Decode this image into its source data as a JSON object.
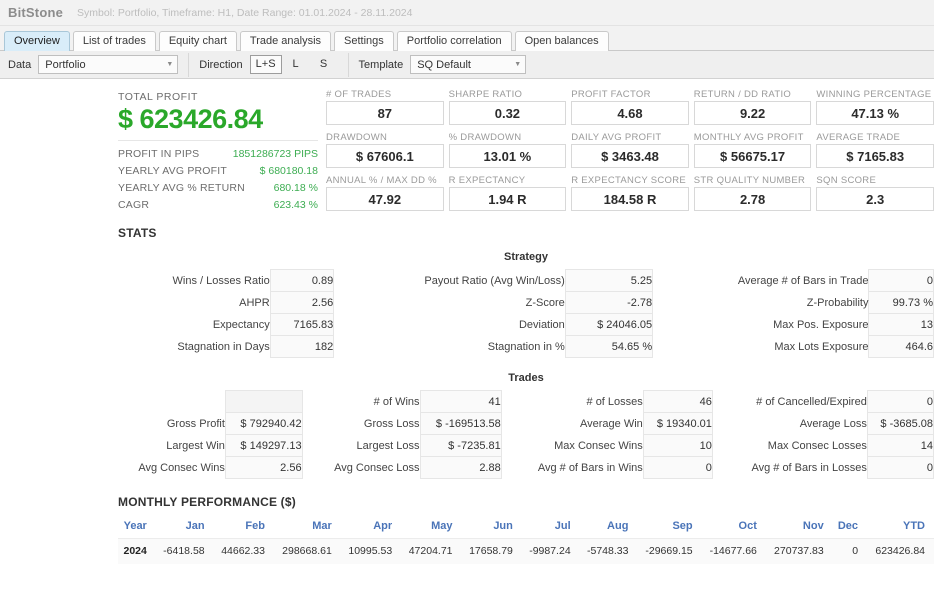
{
  "titlebar": {
    "app_name": "BitStone",
    "meta": "Symbol: Portfolio, Timeframe: H1, Date Range: 01.01.2024 - 28.11.2024"
  },
  "tabs": [
    {
      "label": "Overview",
      "active": true
    },
    {
      "label": "List of trades",
      "active": false
    },
    {
      "label": "Equity chart",
      "active": false
    },
    {
      "label": "Trade analysis",
      "active": false
    },
    {
      "label": "Settings",
      "active": false
    },
    {
      "label": "Portfolio correlation",
      "active": false
    },
    {
      "label": "Open balances",
      "active": false
    }
  ],
  "toolbar": {
    "data_label": "Data",
    "data_value": "Portfolio",
    "direction_label": "Direction",
    "direction_options": [
      "L+S",
      "L",
      "S"
    ],
    "direction_selected": "L+S",
    "template_label": "Template",
    "template_value": "SQ Default"
  },
  "summary": {
    "total_profit_label": "TOTAL PROFIT",
    "total_profit_value": "$ 623426.84",
    "mini": [
      {
        "key": "PROFIT IN PIPS",
        "value": "1851286723 PIPS"
      },
      {
        "key": "YEARLY AVG PROFIT",
        "value": "$ 680180.18"
      },
      {
        "key": "YEARLY AVG % RETURN",
        "value": "680.18 %"
      },
      {
        "key": "CAGR",
        "value": "623.43 %"
      }
    ]
  },
  "kpis": [
    {
      "label": "# OF TRADES",
      "value": "87"
    },
    {
      "label": "SHARPE RATIO",
      "value": "0.32"
    },
    {
      "label": "PROFIT FACTOR",
      "value": "4.68"
    },
    {
      "label": "RETURN / DD RATIO",
      "value": "9.22"
    },
    {
      "label": "WINNING PERCENTAGE",
      "value": "47.13 %"
    },
    {
      "label": "DRAWDOWN",
      "value": "$ 67606.1"
    },
    {
      "label": "% DRAWDOWN",
      "value": "13.01 %"
    },
    {
      "label": "DAILY AVG PROFIT",
      "value": "$ 3463.48"
    },
    {
      "label": "MONTHLY AVG PROFIT",
      "value": "$ 56675.17"
    },
    {
      "label": "AVERAGE TRADE",
      "value": "$ 7165.83"
    },
    {
      "label": "ANNUAL % / MAX DD %",
      "value": "47.92"
    },
    {
      "label": "R EXPECTANCY",
      "value": "1.94 R"
    },
    {
      "label": "R EXPECTANCY SCORE",
      "value": "184.58 R"
    },
    {
      "label": "STR QUALITY NUMBER",
      "value": "2.78"
    },
    {
      "label": "SQN SCORE",
      "value": "2.3"
    }
  ],
  "stats": {
    "heading": "STATS",
    "strategy": {
      "title": "Strategy",
      "rows": [
        [
          {
            "key": "Wins / Losses Ratio",
            "value": "0.89"
          },
          {
            "key": "Payout Ratio (Avg Win/Loss)",
            "value": "5.25"
          },
          {
            "key": "Average # of Bars in Trade",
            "value": "0"
          }
        ],
        [
          {
            "key": "AHPR",
            "value": "2.56"
          },
          {
            "key": "Z-Score",
            "value": "-2.78"
          },
          {
            "key": "Z-Probability",
            "value": "99.73 %"
          }
        ],
        [
          {
            "key": "Expectancy",
            "value": "7165.83"
          },
          {
            "key": "Deviation",
            "value": "$ 24046.05"
          },
          {
            "key": "Max Pos. Exposure",
            "value": "13"
          }
        ],
        [
          {
            "key": "Stagnation in Days",
            "value": "182"
          },
          {
            "key": "Stagnation in %",
            "value": "54.65 %"
          },
          {
            "key": "Max Lots Exposure",
            "value": "464.6"
          }
        ]
      ]
    },
    "trades": {
      "title": "Trades",
      "rows": [
        [
          {
            "key": "",
            "value": ""
          },
          {
            "key": "# of Wins",
            "value": "41"
          },
          {
            "key": "# of Losses",
            "value": "46"
          },
          {
            "key": "# of Cancelled/Expired",
            "value": "0"
          }
        ],
        [
          {
            "key": "Gross Profit",
            "value": "$ 792940.42"
          },
          {
            "key": "Gross Loss",
            "value": "$ -169513.58"
          },
          {
            "key": "Average Win",
            "value": "$ 19340.01"
          },
          {
            "key": "Average Loss",
            "value": "$ -3685.08"
          }
        ],
        [
          {
            "key": "Largest Win",
            "value": "$ 149297.13"
          },
          {
            "key": "Largest Loss",
            "value": "$ -7235.81"
          },
          {
            "key": "Max Consec Wins",
            "value": "10"
          },
          {
            "key": "Max Consec Losses",
            "value": "14"
          }
        ],
        [
          {
            "key": "Avg Consec Wins",
            "value": "2.56"
          },
          {
            "key": "Avg Consec Loss",
            "value": "2.88"
          },
          {
            "key": "Avg # of Bars in Wins",
            "value": "0"
          },
          {
            "key": "Avg # of Bars in Losses",
            "value": "0"
          }
        ]
      ]
    }
  },
  "monthly": {
    "heading": "MONTHLY PERFORMANCE ($)",
    "columns": [
      "Year",
      "Jan",
      "Feb",
      "Mar",
      "Apr",
      "May",
      "Jun",
      "Jul",
      "Aug",
      "Sep",
      "Oct",
      "Nov",
      "Dec",
      "YTD"
    ],
    "rows": [
      {
        "year": "2024",
        "values": [
          "-6418.58",
          "44662.33",
          "298668.61",
          "10995.53",
          "47204.71",
          "17658.79",
          "-9987.24",
          "-5748.33",
          "-29669.15",
          "-14677.66",
          "270737.83",
          "0",
          "623426.84"
        ]
      }
    ]
  },
  "colors": {
    "profit_green": "#2aa82a",
    "mini_green": "#3dad52",
    "negative_red": "#e8524a",
    "month_header_blue": "#4a74b8",
    "active_tab_blue": "#d9edf9"
  }
}
